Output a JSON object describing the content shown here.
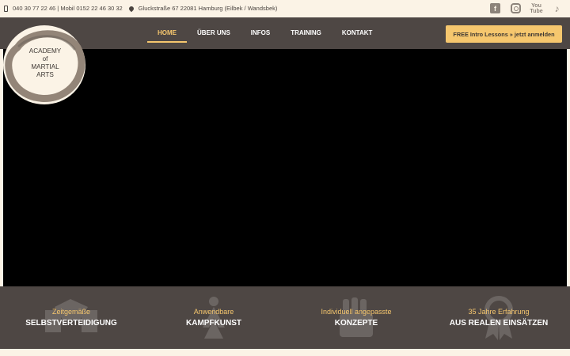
{
  "topbar": {
    "phone_text": "040 30 77 22 46 | Mobil 0152 22 46 30 32",
    "address_text": "Gluckstraße 67 22081 Hamburg (Eilbek / Wandsbek)",
    "social_icons": [
      "facebook-icon",
      "instagram-icon",
      "youtube-icon",
      "tiktok-icon"
    ]
  },
  "logo": {
    "line1": "ACADEMY",
    "line2": "of",
    "line3": "MARTIAL",
    "line4": "ARTS"
  },
  "nav": {
    "items": [
      {
        "label": "HOME"
      },
      {
        "label": "ÜBER UNS"
      },
      {
        "label": "INFOS"
      },
      {
        "label": "TRAINING"
      },
      {
        "label": "KONTAKT"
      }
    ],
    "active": "HOME",
    "cta_label": "FREE Intro Lessons » jetzt anmelden"
  },
  "features": [
    {
      "sub": "Zeitgemäße",
      "main": "SELBSTVERTEIDIGUNG",
      "icon": "handshake-icon"
    },
    {
      "sub": "Anwendbare",
      "main": "KAMPFKUNST",
      "icon": "fighter-icon"
    },
    {
      "sub": "Individuell angepasste",
      "main": "KONZEPTE",
      "icon": "hand-icon"
    },
    {
      "sub": "35 Jahre Erfahrung",
      "main": "AUS REALEN EINSÄTZEN",
      "icon": "medal-icon"
    }
  ],
  "colors": {
    "accent": "#f6c76e",
    "bar": "#4e4744",
    "cream": "#fbf3e6",
    "hero": "#000000"
  }
}
